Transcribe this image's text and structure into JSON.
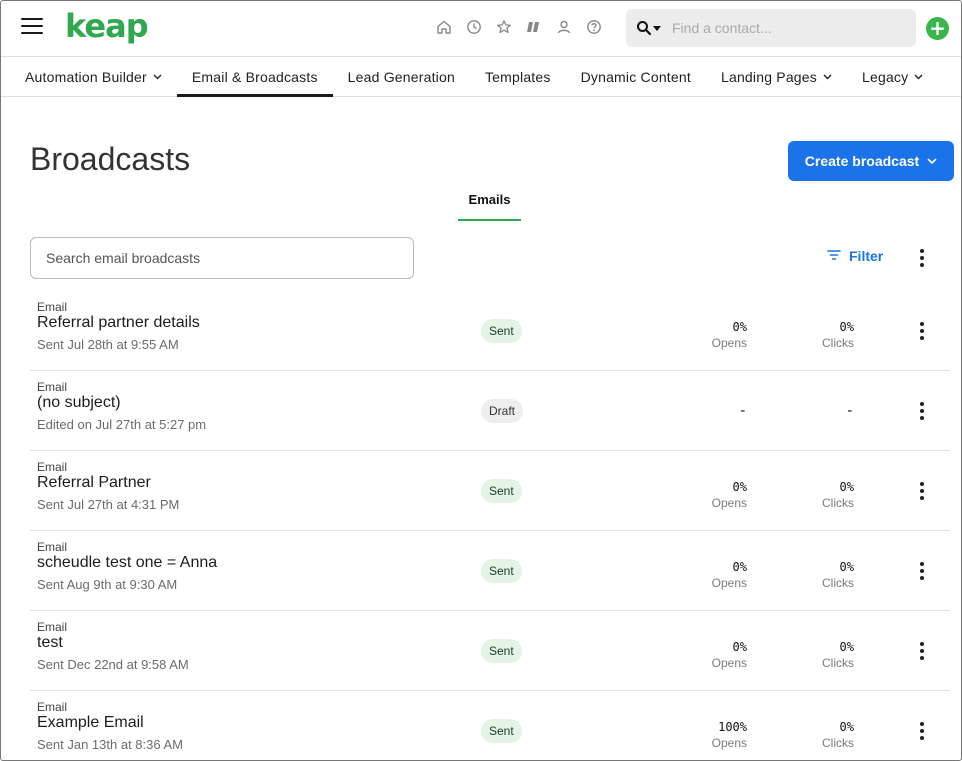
{
  "app": {
    "logo": "keap"
  },
  "header": {
    "icons": [
      "home-icon",
      "clock-icon",
      "star-icon",
      "pipeline-icon",
      "person-icon",
      "help-icon"
    ],
    "search": {
      "placeholder": "Find a contact..."
    },
    "add_label": "+"
  },
  "nav": {
    "items": [
      {
        "label": "Automation Builder",
        "chevron": "⌄"
      },
      {
        "label": "Email & Broadcasts",
        "chevron": ""
      },
      {
        "label": "Lead Generation",
        "chevron": ""
      },
      {
        "label": "Templates",
        "chevron": ""
      },
      {
        "label": "Dynamic Content",
        "chevron": ""
      },
      {
        "label": "Landing Pages",
        "chevron": "⌄"
      },
      {
        "label": "Legacy",
        "chevron": "⌄"
      }
    ]
  },
  "page": {
    "title": "Broadcasts",
    "create_label": "Create broadcast",
    "tab_label": "Emails",
    "search_placeholder": "Search email broadcasts",
    "filter_label": "Filter"
  },
  "rows": [
    {
      "type": "Email",
      "name": "Referral partner details",
      "date": "Sent Jul 28th at 9:55 AM",
      "status": "Sent",
      "opens": "0%",
      "opens_label": "Opens",
      "clicks": "0%",
      "clicks_label": "Clicks"
    },
    {
      "type": "Email",
      "name": "(no subject)",
      "date": "Edited on Jul 27th at 5:27 pm",
      "status": "Draft",
      "opens": "-",
      "opens_label": "",
      "clicks": "-",
      "clicks_label": ""
    },
    {
      "type": "Email",
      "name": "Referral Partner",
      "date": "Sent Jul 27th at 4:31 PM",
      "status": "Sent",
      "opens": "0%",
      "opens_label": "Opens",
      "clicks": "0%",
      "clicks_label": "Clicks"
    },
    {
      "type": "Email",
      "name": "scheudle test one = Anna",
      "date": "Sent Aug 9th at 9:30 AM",
      "status": "Sent",
      "opens": "0%",
      "opens_label": "Opens",
      "clicks": "0%",
      "clicks_label": "Clicks"
    },
    {
      "type": "Email",
      "name": "test",
      "date": "Sent Dec 22nd at 9:58 AM",
      "status": "Sent",
      "opens": "0%",
      "opens_label": "Opens",
      "clicks": "0%",
      "clicks_label": "Clicks"
    },
    {
      "type": "Email",
      "name": "Example Email",
      "date": "Sent Jan 13th at 8:36 AM",
      "status": "Sent",
      "opens": "100%",
      "opens_label": "Opens",
      "clicks": "0%",
      "clicks_label": "Clicks"
    }
  ],
  "colors": {
    "brand": "#2fa84f",
    "primary": "#1a73e8",
    "sent_badge": "#e3f3e6",
    "draft_badge": "#eeeeee"
  }
}
